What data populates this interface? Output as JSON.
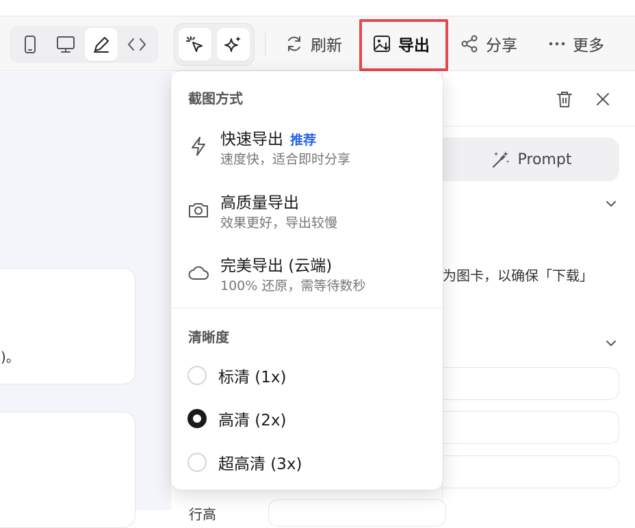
{
  "toolbar": {
    "device_modes": [
      {
        "icon": "mobile-icon",
        "active": false
      },
      {
        "icon": "desktop-icon",
        "active": false
      },
      {
        "icon": "pen-icon",
        "active": true
      },
      {
        "icon": "code-icon",
        "active": false
      }
    ],
    "tool_modes": [
      {
        "icon": "cursor-click-icon"
      },
      {
        "icon": "sparkle-icon"
      }
    ],
    "refresh_label": "刷新",
    "export_label": "导出",
    "share_label": "分享",
    "more_label": "更多",
    "highlight_color": "#e5484d"
  },
  "export_menu": {
    "section_method": "截图方式",
    "items": [
      {
        "icon": "lightning-icon",
        "title": "快速导出",
        "tag": "推荐",
        "subtitle": "速度快，适合即时分享"
      },
      {
        "icon": "camera-icon",
        "title": "高质量导出",
        "tag": "",
        "subtitle": "效果更好，导出较慢"
      },
      {
        "icon": "cloud-icon",
        "title": "完美导出 (云端)",
        "tag": "",
        "subtitle": "100% 还原，需等待数秒"
      }
    ],
    "section_resolution": "清晰度",
    "resolutions": [
      {
        "label": "标清 (1x)",
        "checked": false
      },
      {
        "label": "高清 (2x)",
        "checked": true
      },
      {
        "label": "超高清 (3x)",
        "checked": false
      }
    ],
    "tag_color": "#2563eb"
  },
  "right_panel": {
    "prompt_label": "Prompt",
    "partial_text": "为图卡，以确保「下载」"
  },
  "left_panel": {
    "card_text": ")。",
    "bottom_label": "行高"
  }
}
